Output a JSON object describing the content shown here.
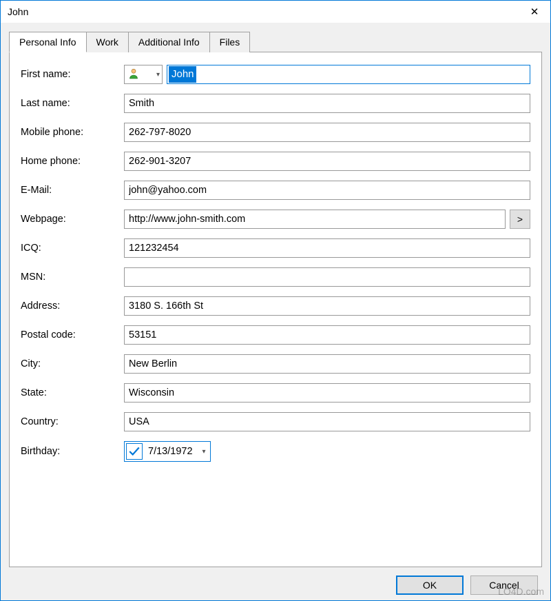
{
  "window": {
    "title": "John"
  },
  "tabs": [
    {
      "label": "Personal Info",
      "active": true
    },
    {
      "label": "Work",
      "active": false
    },
    {
      "label": "Additional Info",
      "active": false
    },
    {
      "label": "Files",
      "active": false
    }
  ],
  "form": {
    "first_name": {
      "label": "First name:",
      "value": "John"
    },
    "last_name": {
      "label": "Last name:",
      "value": "Smith"
    },
    "mobile_phone": {
      "label": "Mobile phone:",
      "value": "262-797-8020"
    },
    "home_phone": {
      "label": "Home phone:",
      "value": "262-901-3207"
    },
    "email": {
      "label": "E-Mail:",
      "value": "john@yahoo.com"
    },
    "webpage": {
      "label": "Webpage:",
      "value": "http://www.john-smith.com",
      "go": ">"
    },
    "icq": {
      "label": "ICQ:",
      "value": "121232454"
    },
    "msn": {
      "label": "MSN:",
      "value": ""
    },
    "address": {
      "label": "Address:",
      "value": "3180 S. 166th St"
    },
    "postal": {
      "label": "Postal code:",
      "value": "53151"
    },
    "city": {
      "label": "City:",
      "value": "New Berlin"
    },
    "state": {
      "label": "State:",
      "value": "Wisconsin"
    },
    "country": {
      "label": "Country:",
      "value": "USA"
    },
    "birthday": {
      "label": "Birthday:",
      "value": "7/13/1972",
      "checked": true
    }
  },
  "buttons": {
    "ok": "OK",
    "cancel": "Cancel"
  },
  "watermark": "LO4D.com"
}
